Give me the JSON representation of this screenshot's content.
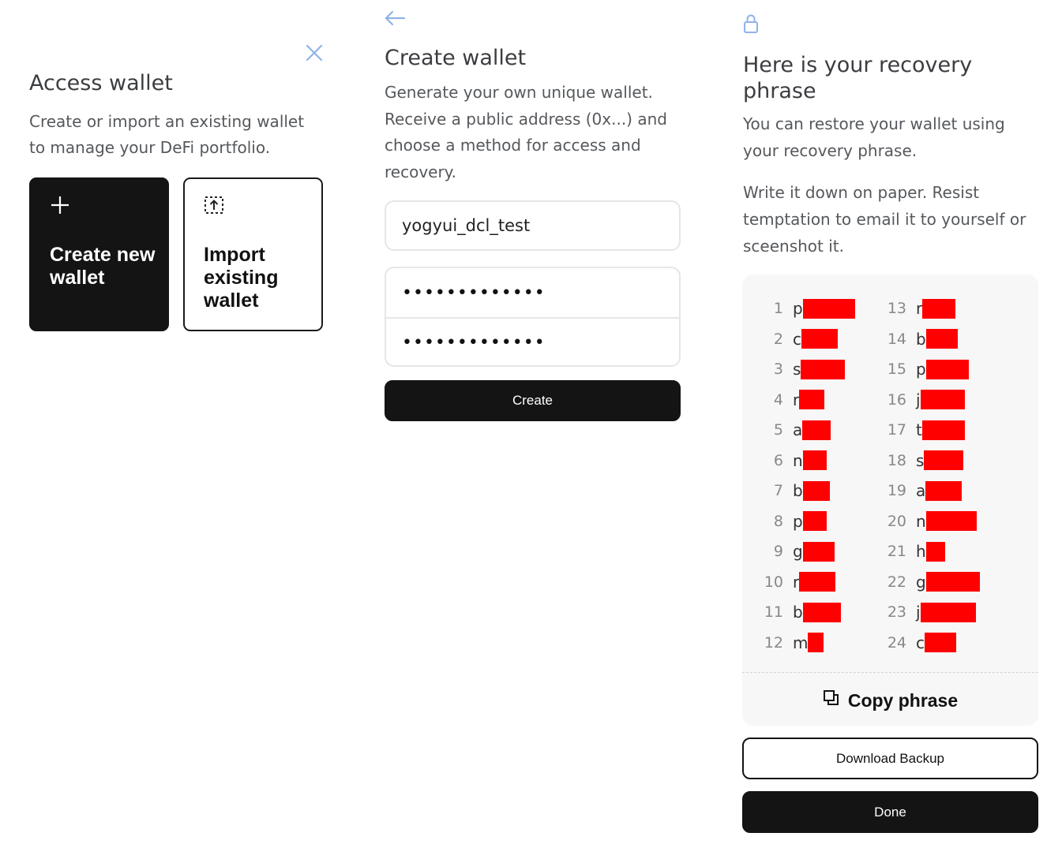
{
  "access_wallet": {
    "title": "Access wallet",
    "subtitle": "Create or import an existing wallet to manage your DeFi portfolio.",
    "create_card_label": "Create new wallet",
    "import_card_label": "Import existing wallet",
    "close_icon": "close-icon",
    "plus_icon": "plus-icon",
    "import_icon": "import-upload-icon"
  },
  "create_wallet": {
    "title": "Create wallet",
    "subtitle": "Generate your own unique wallet. Receive a public address (0x...) and choose a method for access and recovery.",
    "name_value": "yogyui_dcl_test",
    "password_mask": "•••••••••••••",
    "confirm_password_mask": "•••••••••••••",
    "create_button": "Create",
    "back_icon": "arrow-left-icon"
  },
  "recovery": {
    "title": "Here is your recovery phrase",
    "subtitle": "You can restore your wallet using your recovery phrase.",
    "warning": "Write it down on paper. Resist temptation to email it to yourself or sceenshot it.",
    "lock_icon": "lock-icon",
    "words": [
      {
        "n": "1",
        "first": "p"
      },
      {
        "n": "2",
        "first": "c"
      },
      {
        "n": "3",
        "first": "s"
      },
      {
        "n": "4",
        "first": "r"
      },
      {
        "n": "5",
        "first": "a"
      },
      {
        "n": "6",
        "first": "n"
      },
      {
        "n": "7",
        "first": "b"
      },
      {
        "n": "8",
        "first": "p"
      },
      {
        "n": "9",
        "first": "g"
      },
      {
        "n": "10",
        "first": "r"
      },
      {
        "n": "11",
        "first": "b"
      },
      {
        "n": "12",
        "first": "m"
      },
      {
        "n": "13",
        "first": "r"
      },
      {
        "n": "14",
        "first": "b"
      },
      {
        "n": "15",
        "first": "p"
      },
      {
        "n": "16",
        "first": "j"
      },
      {
        "n": "17",
        "first": "t"
      },
      {
        "n": "18",
        "first": "s"
      },
      {
        "n": "19",
        "first": "a"
      },
      {
        "n": "20",
        "first": "n"
      },
      {
        "n": "21",
        "first": "h"
      },
      {
        "n": "22",
        "first": "g"
      },
      {
        "n": "23",
        "first": "j"
      },
      {
        "n": "24",
        "first": "c"
      }
    ],
    "copy_button": "Copy phrase",
    "copy_icon": "copy-icon",
    "download_button": "Download Backup",
    "done_button": "Done",
    "redaction_color": "#ff0000"
  }
}
